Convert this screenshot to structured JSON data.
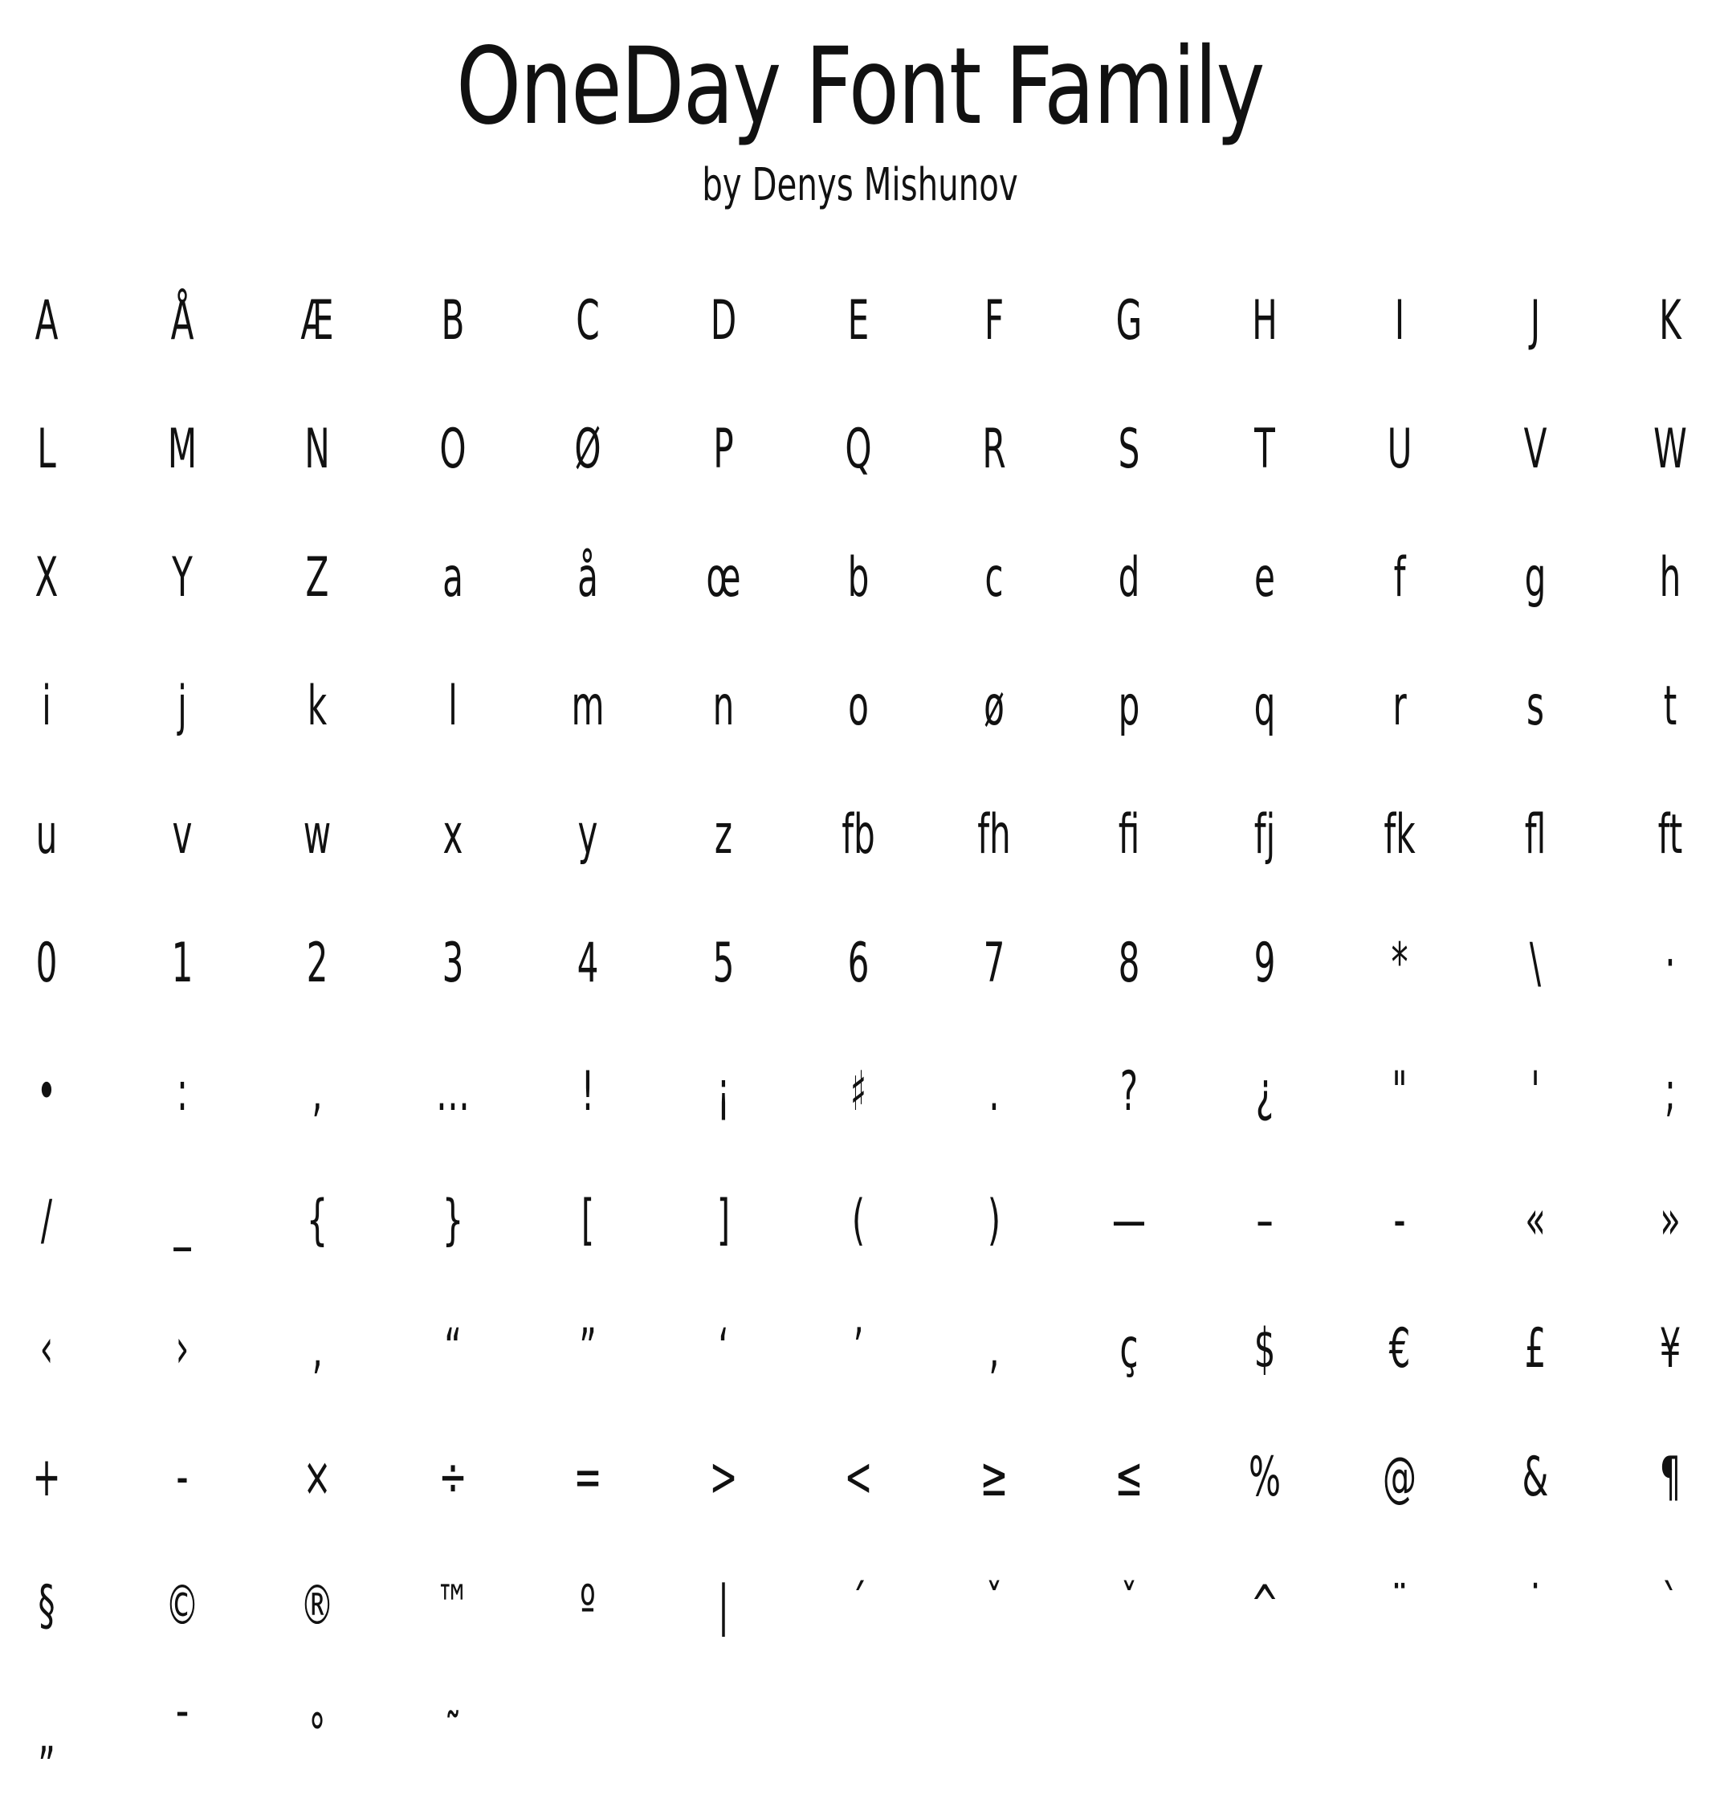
{
  "header": {
    "title": "OneDay Font Family",
    "subtitle": "by Denys Mishunov"
  },
  "glyph_rows": [
    [
      "A",
      "Å",
      "Æ",
      "B",
      "C",
      "D",
      "E",
      "F",
      "G",
      "H",
      "I",
      "J",
      "K"
    ],
    [
      "L",
      "M",
      "N",
      "O",
      "Ø",
      "P",
      "Q",
      "R",
      "S",
      "T",
      "U",
      "V",
      "W"
    ],
    [
      "X",
      "Y",
      "Z",
      "a",
      "å",
      "œ",
      "b",
      "c",
      "d",
      "e",
      "f",
      "g",
      "h"
    ],
    [
      "i",
      "j",
      "k",
      "l",
      "m",
      "n",
      "o",
      "ø",
      "p",
      "q",
      "r",
      "s",
      "t"
    ],
    [
      "u",
      "v",
      "w",
      "x",
      "y",
      "z",
      "fb",
      "fh",
      "fi",
      "fj",
      "fk",
      "fl",
      "ft"
    ],
    [
      "0",
      "1",
      "2",
      "3",
      "4",
      "5",
      "6",
      "7",
      "8",
      "9",
      "*",
      "\\",
      "·"
    ],
    [
      "•",
      ":",
      ",",
      "…",
      "!",
      "¡",
      "♯",
      ".",
      "?",
      "¿",
      "\"",
      "'",
      ";"
    ],
    [
      "/",
      "_",
      "{",
      "}",
      "[",
      "]",
      "(",
      ")",
      "—",
      "–",
      "-",
      "«",
      "»"
    ],
    [
      "‹",
      "›",
      "‚",
      "“",
      "”",
      "‘",
      "’",
      ",",
      "ç",
      "$",
      "€",
      "£",
      "¥"
    ],
    [
      "+",
      "-",
      "×",
      "÷",
      "=",
      ">",
      "<",
      "≥",
      "≤",
      "%",
      "@",
      "&",
      "¶"
    ],
    [
      "§",
      "©",
      "®",
      "™",
      "º",
      "|",
      "´",
      "ˇ",
      "ˇ",
      "^",
      "¨",
      "˙",
      "`"
    ],
    [
      "„",
      "¯",
      "°",
      "˜"
    ]
  ]
}
